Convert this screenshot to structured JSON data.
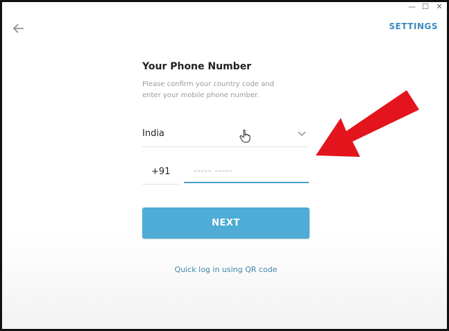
{
  "window": {
    "controls": [
      "—",
      "☐",
      "✕"
    ]
  },
  "header": {
    "back_icon": "arrow-left-icon",
    "settings_label": "SETTINGS"
  },
  "login": {
    "title": "Your Phone Number",
    "subtitle": "Please confirm your country code and enter your mobile phone number.",
    "country": {
      "selected": "India",
      "dropdown_icon": "chevron-down-icon"
    },
    "phone": {
      "country_code": "+91",
      "placeholder": "----- -----",
      "value": ""
    },
    "next_label": "NEXT",
    "qr_link_label": "Quick log in using QR code"
  },
  "annotation": {
    "arrow_icon": "red-pointer-arrow-icon",
    "arrow_color": "#e3141b"
  },
  "colors": {
    "accent": "#4eacd6",
    "link": "#3a8bbf",
    "focus_underline": "#4a9fc9"
  }
}
